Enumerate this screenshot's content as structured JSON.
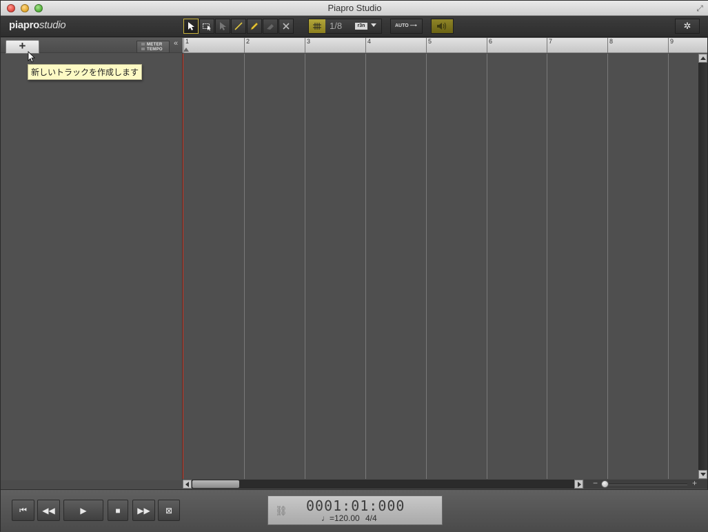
{
  "window": {
    "title": "Piapro Studio"
  },
  "toolbar": {
    "logo_bold": "piapro",
    "logo_light": "studio",
    "tools": [
      {
        "name": "pointer-tool",
        "icon": "arrow-cursor-icon",
        "active": true
      },
      {
        "name": "marquee-tool",
        "icon": "box-select-icon",
        "active": false
      },
      {
        "name": "pointer-alt-tool",
        "icon": "arrow-select-icon",
        "active": false
      },
      {
        "name": "line-tool",
        "icon": "line-icon",
        "active": false
      },
      {
        "name": "pencil-tool",
        "icon": "pencil-icon",
        "active": false
      },
      {
        "name": "eraser-tool",
        "icon": "eraser-icon",
        "active": false
      },
      {
        "name": "delete-tool",
        "icon": "x-icon",
        "active": false
      }
    ],
    "quantize_value": "1/8",
    "triplet_label": "r3n",
    "auto_label": "AUTO",
    "settings_icon": "gear-icon"
  },
  "track_panel": {
    "add_track_label": "+",
    "meter_label": "METER",
    "tempo_label": "TEMPO",
    "collapse_label": "«",
    "tooltip": "新しいトラックを作成します"
  },
  "timeline": {
    "measures": [
      "1",
      "2",
      "3",
      "4",
      "5",
      "6",
      "7",
      "8",
      "9"
    ]
  },
  "transport": {
    "position": "0001:01:000",
    "tempo": "♩=120.00",
    "meter": "4/4",
    "buttons": [
      {
        "name": "go-to-start-button",
        "glyph": "⏮"
      },
      {
        "name": "rewind-button",
        "glyph": "◀◀"
      },
      {
        "name": "play-button",
        "glyph": "▶"
      },
      {
        "name": "stop-button",
        "glyph": "■"
      },
      {
        "name": "fast-forward-button",
        "glyph": "▶▶"
      },
      {
        "name": "loop-button",
        "glyph": "⊠"
      }
    ]
  },
  "colors": {
    "playhead": "#d0321f",
    "accent": "#b3a63a"
  }
}
